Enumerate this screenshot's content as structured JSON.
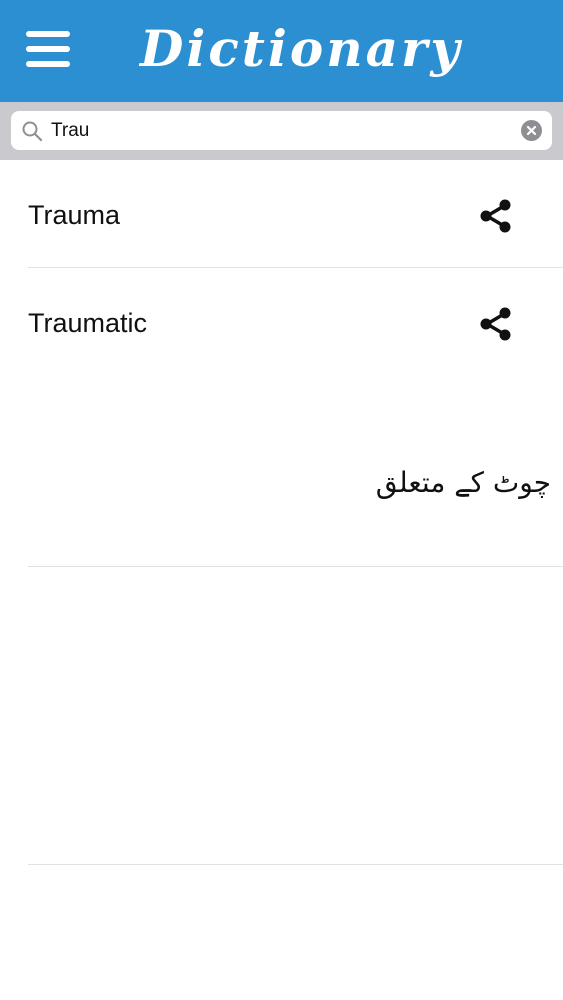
{
  "header": {
    "title": "Dictionary",
    "background_color": "#2b8fd2"
  },
  "search": {
    "query": "Trau",
    "placeholder": ""
  },
  "results": [
    {
      "word": "Trauma",
      "meaning": ""
    },
    {
      "word": "Traumatic",
      "meaning": "چوٹ کے متعلق"
    }
  ],
  "icons": {
    "menu": "hamburger-menu-icon",
    "search": "magnifier-icon",
    "clear": "clear-circle-icon",
    "share": "share-icon"
  }
}
